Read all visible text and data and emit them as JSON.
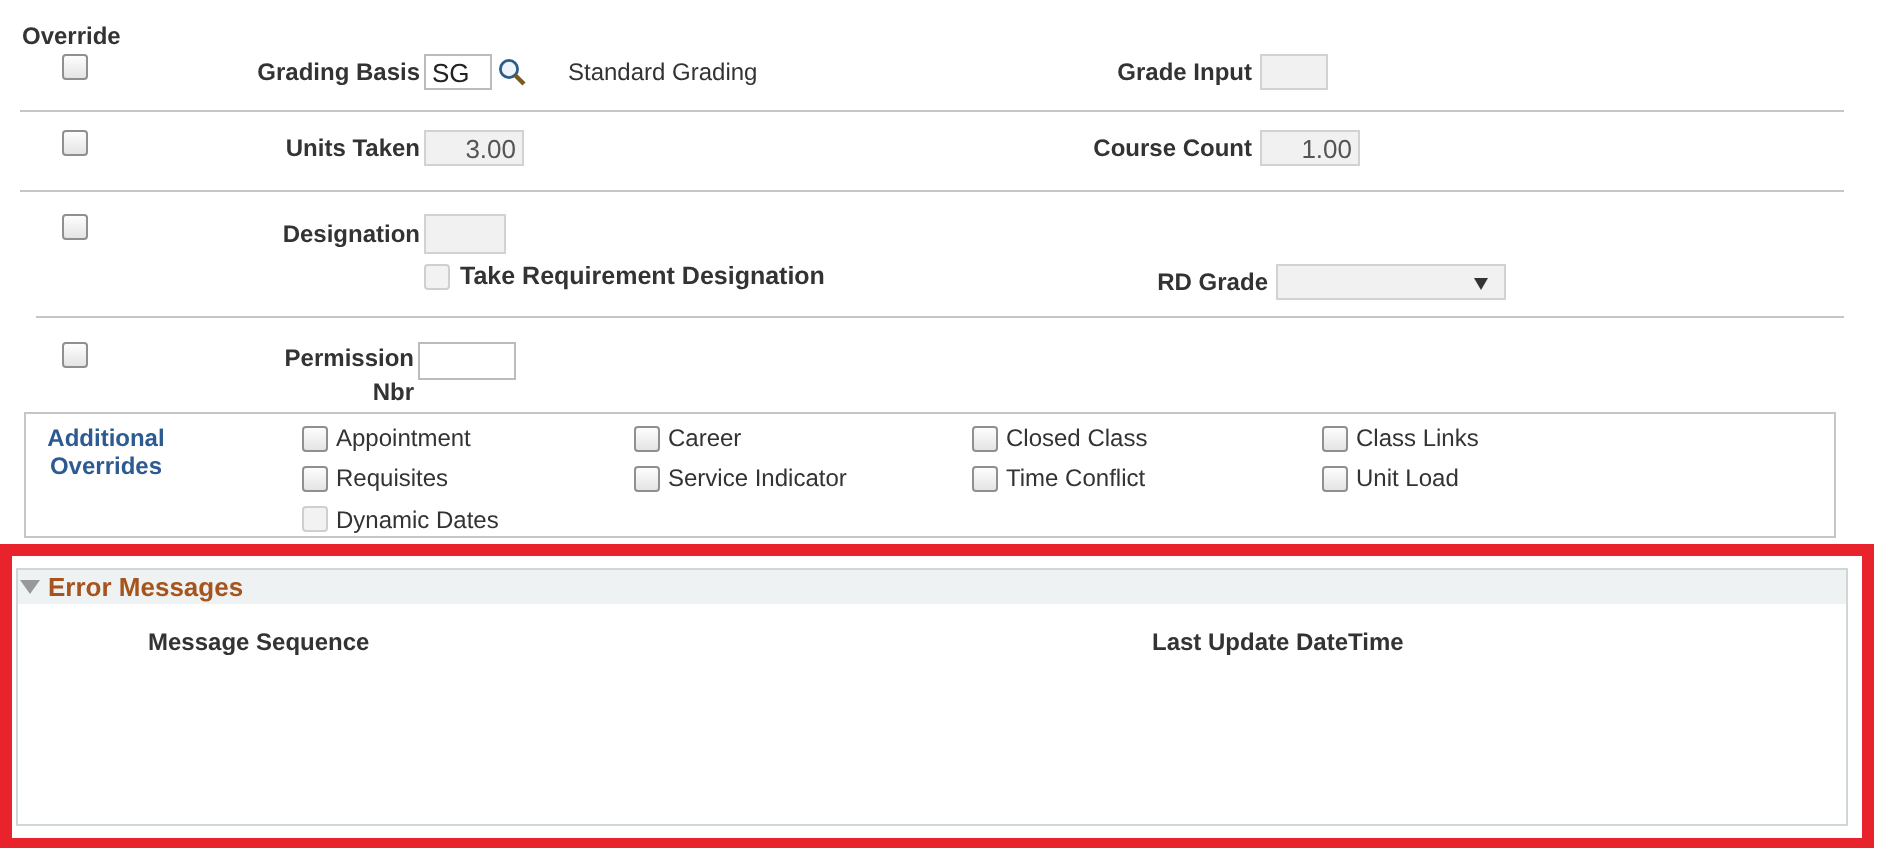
{
  "override_header": "Override",
  "rows": [
    {
      "override": {
        "checked": false
      },
      "left": {
        "label": "Grading Basis",
        "kind": "text",
        "value": "SG",
        "disabled": false,
        "lookup": true,
        "description": "Standard Grading"
      },
      "right": {
        "label": "Grade Input",
        "kind": "text",
        "disabled": true
      }
    },
    {
      "override": {
        "checked": false
      },
      "left": {
        "label": "Units Taken",
        "kind": "number",
        "value": "3.00",
        "disabled": true
      },
      "right": {
        "label": "Course Count",
        "kind": "number",
        "value": "1.00",
        "disabled": true
      }
    },
    {
      "override": {
        "checked": false
      },
      "left": {
        "label": "Designation",
        "kind": "text",
        "disabled": true,
        "option": {
          "label": "Take Requirement Designation",
          "checked": false,
          "disabled": true
        }
      },
      "right": {
        "label": "RD Grade",
        "kind": "select",
        "disabled": true
      }
    },
    {
      "override": {
        "checked": false
      },
      "left": {
        "label": "Permission Nbr",
        "kind": "text",
        "disabled": false
      }
    }
  ],
  "additional_overrides": {
    "label": "Additional Overrides",
    "items": [
      {
        "label": "Appointment",
        "checked": false,
        "disabled": false
      },
      {
        "label": "Career",
        "checked": false,
        "disabled": false
      },
      {
        "label": "Closed Class",
        "checked": false,
        "disabled": false
      },
      {
        "label": "Class Links",
        "checked": false,
        "disabled": false
      },
      {
        "label": "Requisites",
        "checked": false,
        "disabled": false
      },
      {
        "label": "Service Indicator",
        "checked": false,
        "disabled": false
      },
      {
        "label": "Time Conflict",
        "checked": false,
        "disabled": false
      },
      {
        "label": "Unit Load",
        "checked": false,
        "disabled": false
      },
      {
        "label": "Dynamic Dates",
        "checked": false,
        "disabled": true
      }
    ]
  },
  "error_messages": {
    "title": "Error Messages",
    "expanded": true,
    "highlighted": true,
    "columns": [
      "Message Sequence",
      "Last Update DateTime"
    ]
  }
}
